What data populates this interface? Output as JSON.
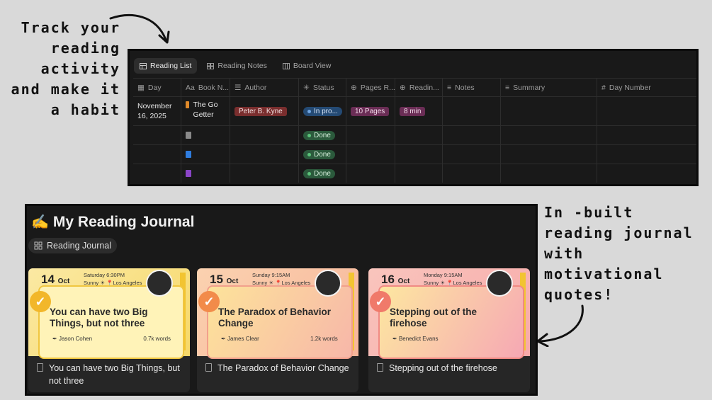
{
  "captions": {
    "top_left": "Track your reading activity and make it a habit",
    "right": "In -built reading journal with motivational quotes!"
  },
  "reading_list": {
    "tabs": [
      "Reading List",
      "Reading Notes",
      "Board View"
    ],
    "columns": [
      "Day",
      "Book N...",
      "Author",
      "Status",
      "Pages R...",
      "Readin...",
      "Notes",
      "Summary",
      "Day Number"
    ],
    "rows": [
      {
        "day": "November 16, 2025",
        "book": "The Go Getter",
        "author": "Peter B. Kyne",
        "status": "In pro...",
        "pages": "10 Pages",
        "minutes": "8 min"
      },
      {
        "day": "",
        "book": "",
        "author": "",
        "status": "Done",
        "pages": "",
        "minutes": ""
      },
      {
        "day": "",
        "book": "",
        "author": "",
        "status": "Done",
        "pages": "",
        "minutes": ""
      },
      {
        "day": "",
        "book": "",
        "author": "",
        "status": "Done",
        "pages": "",
        "minutes": ""
      }
    ]
  },
  "journal": {
    "title": "My Reading Journal",
    "view": "Reading Journal",
    "cards": [
      {
        "day": "14",
        "month": "Oct",
        "weekday_time": "Saturday 6:30PM",
        "weather": "Sunny",
        "location": "Los Angeles",
        "quote": "You can have two Big Things, but not three",
        "quote_author": "Jason Cohen",
        "words": "0.7k words",
        "title": "You can have two Big Things, but not three",
        "accent": "#f2c431"
      },
      {
        "day": "15",
        "month": "Oct",
        "weekday_time": "Sunday 9:15AM",
        "weather": "Sunny",
        "location": "Los Angeles",
        "quote": "The Paradox of Behavior Change",
        "quote_author": "James Clear",
        "words": "1.2k words",
        "title": "The Paradox of Behavior Change",
        "accent": "#f29a4a"
      },
      {
        "day": "16",
        "month": "Oct",
        "weekday_time": "Monday 9:15AM",
        "weather": "Sunny",
        "location": "Los Angeles",
        "quote": "Stepping out of the firehose",
        "quote_author": "Benedict Evans",
        "words": "",
        "title": "Stepping out of the firehose",
        "accent": "#f07a6a"
      }
    ]
  }
}
